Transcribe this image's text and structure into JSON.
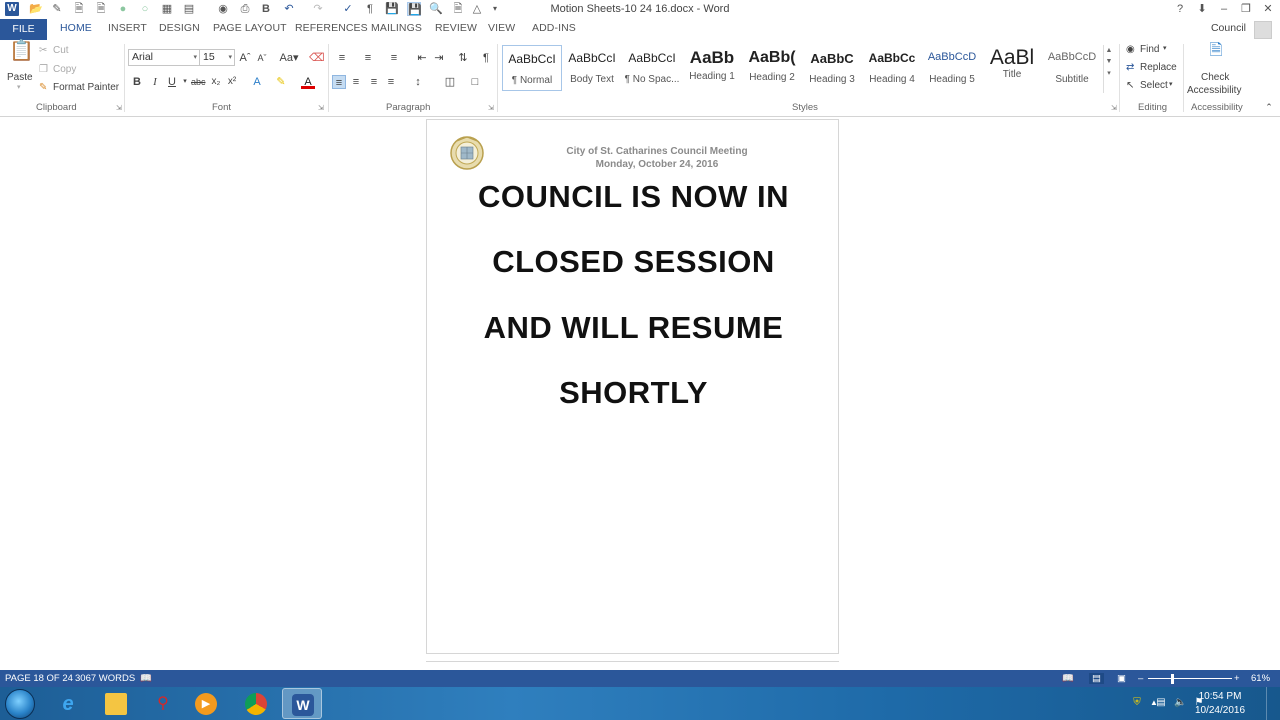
{
  "window": {
    "title": "Motion Sheets-10 24 16.docx - Word",
    "help": "?",
    "user": "Council"
  },
  "tabs": {
    "file": "FILE",
    "home": "HOME",
    "insert": "INSERT",
    "design": "DESIGN",
    "page_layout": "PAGE LAYOUT",
    "references": "REFERENCES",
    "mailings": "MAILINGS",
    "review": "REVIEW",
    "view": "VIEW",
    "add_ins": "ADD-INS"
  },
  "clipboard": {
    "paste": "Paste",
    "cut": "Cut",
    "copy": "Copy",
    "format_painter": "Format Painter",
    "label": "Clipboard"
  },
  "font": {
    "name": "Arial",
    "size": "15",
    "label": "Font"
  },
  "paragraph": {
    "label": "Paragraph"
  },
  "styles": {
    "label": "Styles",
    "items": [
      {
        "sample": "AaBbCcI",
        "name": "¶ Normal"
      },
      {
        "sample": "AaBbCcI",
        "name": "Body Text"
      },
      {
        "sample": "AaBbCcI",
        "name": "¶ No Spac..."
      },
      {
        "sample": "AaBb",
        "name": "Heading 1"
      },
      {
        "sample": "AaBb(",
        "name": "Heading 2"
      },
      {
        "sample": "AaBbC",
        "name": "Heading 3"
      },
      {
        "sample": "AaBbCc",
        "name": "Heading 4"
      },
      {
        "sample": "AaBbCcD",
        "name": "Heading 5"
      },
      {
        "sample": "AaBl",
        "name": "Title"
      },
      {
        "sample": "AaBbCcD",
        "name": "Subtitle"
      }
    ]
  },
  "editing": {
    "find": "Find",
    "replace": "Replace",
    "select": "Select",
    "label": "Editing"
  },
  "accessibility": {
    "check_line1": "Check",
    "check_line2": "Accessibility",
    "label": "Accessibility"
  },
  "document": {
    "header_title": "City of St. Catharines Council Meeting",
    "header_date": "Monday, October 24, 2016",
    "lines": [
      "COUNCIL IS NOW IN",
      "CLOSED SESSION",
      "AND WILL RESUME",
      "SHORTLY"
    ]
  },
  "status": {
    "page": "PAGE 18 OF 24",
    "words": "3067 WORDS",
    "zoom": "61%",
    "zoom_fraction": 0.61
  },
  "taskbar": {
    "time": "10:54 PM",
    "date": "10/24/2016"
  },
  "colors": {
    "accent": "#2b579a"
  }
}
